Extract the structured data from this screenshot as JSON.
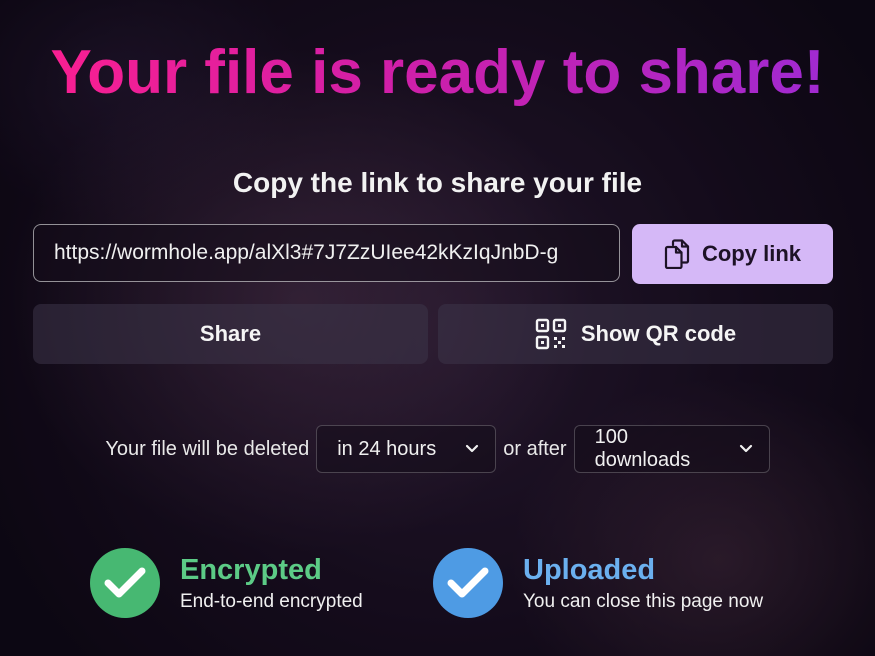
{
  "page": {
    "title": "Your file is ready to share!",
    "subtitle": "Copy the link to share your file"
  },
  "link": {
    "url": "https://wormhole.app/alXl3#7J7ZzUIee42kKzIqJnbD-g",
    "copy_label": "Copy link",
    "copy_icon": "clipboard-copy-icon"
  },
  "actions": {
    "share_label": "Share",
    "qr_label": "Show QR code",
    "qr_icon": "qr-code-icon"
  },
  "expiry": {
    "prefix": "Your file will be deleted",
    "time_value": "in 24 hours",
    "connector": "or after",
    "downloads_value": "100 downloads"
  },
  "status": {
    "encrypted": {
      "title": "Encrypted",
      "subtitle": "End-to-end encrypted",
      "color": "#47b872",
      "icon": "check-icon"
    },
    "uploaded": {
      "title": "Uploaded",
      "subtitle": "You can close this page now",
      "color": "#4e9be4",
      "icon": "check-icon"
    }
  },
  "colors": {
    "title_gradient_start": "#ff1f8e",
    "title_gradient_end": "#9b2bd6",
    "copy_button_bg": "#d5b8f7"
  }
}
